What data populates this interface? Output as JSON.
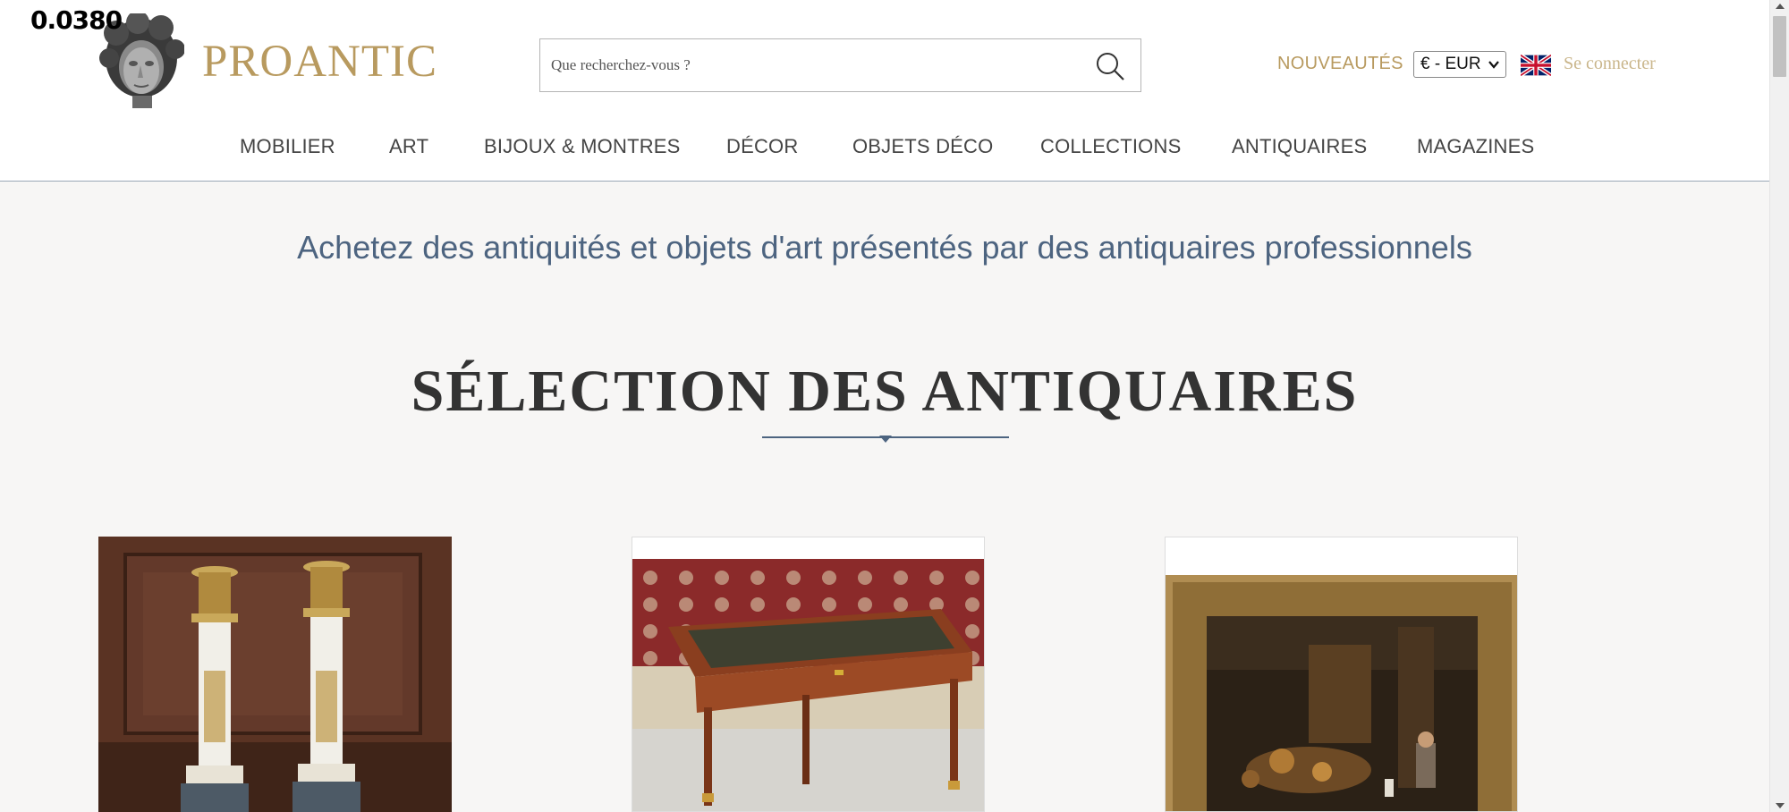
{
  "overlay": {
    "counter": "0.0380"
  },
  "header": {
    "brand": "PROANTIC",
    "search_placeholder": "Que recherchez-vous ?",
    "new_label": "NOUVEAUTÉS",
    "currency": "€ - EUR",
    "login_label": "Se connecter"
  },
  "nav": {
    "items": [
      {
        "label": "MOBILIER"
      },
      {
        "label": "ART"
      },
      {
        "label": "BIJOUX & MONTRES"
      },
      {
        "label": "DÉCOR"
      },
      {
        "label": "OBJETS DÉCO"
      },
      {
        "label": "COLLECTIONS"
      },
      {
        "label": "ANTIQUAIRES"
      },
      {
        "label": "MAGAZINES"
      }
    ]
  },
  "main": {
    "tagline": "Achetez des antiquités et objets d'art présentés par des antiquaires professionnels",
    "section_title": "SÉLECTION DES ANTIQUAIRES"
  },
  "products": [
    {
      "image": "candlesticks-photo"
    },
    {
      "image": "writing-desk-photo"
    },
    {
      "image": "framed-painting-photo"
    }
  ],
  "colors": {
    "brand_gold": "#b89a5f",
    "accent_blue": "#4d6480",
    "background": "#f7f6f5"
  }
}
